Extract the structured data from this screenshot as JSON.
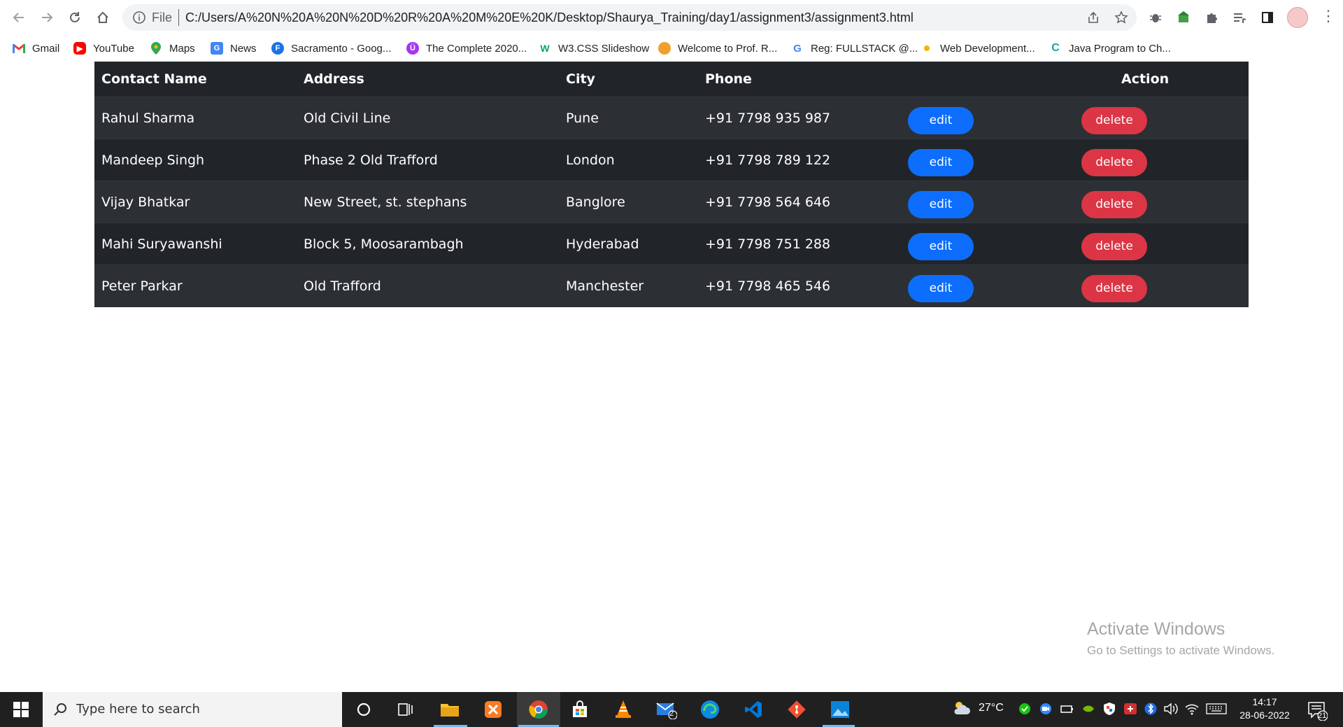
{
  "browser": {
    "address_prefix": "File",
    "url": "C:/Users/A%20N%20A%20N%20D%20R%20A%20M%20E%20K/Desktop/Shaurya_Training/day1/assignment3/assignment3.html"
  },
  "bookmarks": [
    {
      "label": "Gmail",
      "icon": "gmail-icon",
      "color": "#ea4335"
    },
    {
      "label": "YouTube",
      "icon": "youtube-icon",
      "color": "#ff0000"
    },
    {
      "label": "Maps",
      "icon": "maps-icon",
      "color": "#34a853"
    },
    {
      "label": "News",
      "icon": "news-icon",
      "color": "#4285f4"
    },
    {
      "label": "Sacramento - Goog...",
      "icon": "letter-f-icon",
      "color": "#1a73e8"
    },
    {
      "label": "The Complete 2020...",
      "icon": "udemy-icon",
      "color": "#a435f0"
    },
    {
      "label": "W3.CSS Slideshow",
      "icon": "w3schools-icon",
      "color": "#04aa6d"
    },
    {
      "label": "Welcome to Prof. R...",
      "icon": "profile-site-icon",
      "color": "#f0a030"
    },
    {
      "label": "Reg: FULLSTACK @...",
      "icon": "google-icon",
      "color": "#4285f4"
    },
    {
      "label": "Web Development...",
      "icon": "dot-icon",
      "color": "#f4b400"
    },
    {
      "label": "Java Program to Ch...",
      "icon": "c-icon",
      "color": "#1aa3a3"
    }
  ],
  "table": {
    "headers": {
      "name": "Contact Name",
      "address": "Address",
      "city": "City",
      "phone": "Phone",
      "action": "Action"
    },
    "rows": [
      {
        "name": "Rahul Sharma",
        "address": "Old Civil Line",
        "city": "Pune",
        "phone": "+91 7798 935 987",
        "edit": "edit",
        "delete": "delete"
      },
      {
        "name": "Mandeep Singh",
        "address": "Phase 2 Old Trafford",
        "city": "London",
        "phone": "+91 7798 789 122",
        "edit": "edit",
        "delete": "delete"
      },
      {
        "name": "Vijay Bhatkar",
        "address": "New Street, st. stephans",
        "city": "Banglore",
        "phone": "+91 7798 564 646",
        "edit": "edit",
        "delete": "delete"
      },
      {
        "name": "Mahi Suryawanshi",
        "address": "Block 5, Moosarambagh",
        "city": "Hyderabad",
        "phone": "+91 7798 751 288",
        "edit": "edit",
        "delete": "delete"
      },
      {
        "name": "Peter Parkar",
        "address": "Old Trafford",
        "city": "Manchester",
        "phone": "+91 7798 465 546",
        "edit": "edit",
        "delete": "delete"
      }
    ]
  },
  "colors": {
    "table_bg": "#212529",
    "table_stripe": "#2c3034",
    "edit_button": "#0d6efd",
    "delete_button": "#dc3545"
  },
  "watermark": {
    "title": "Activate Windows",
    "subtitle": "Go to Settings to activate Windows."
  },
  "taskbar": {
    "search_placeholder": "Type here to search",
    "weather": "27°C",
    "time": "14:17",
    "date": "28-06-2022",
    "mail_badge": "2",
    "notification_count": "21"
  }
}
